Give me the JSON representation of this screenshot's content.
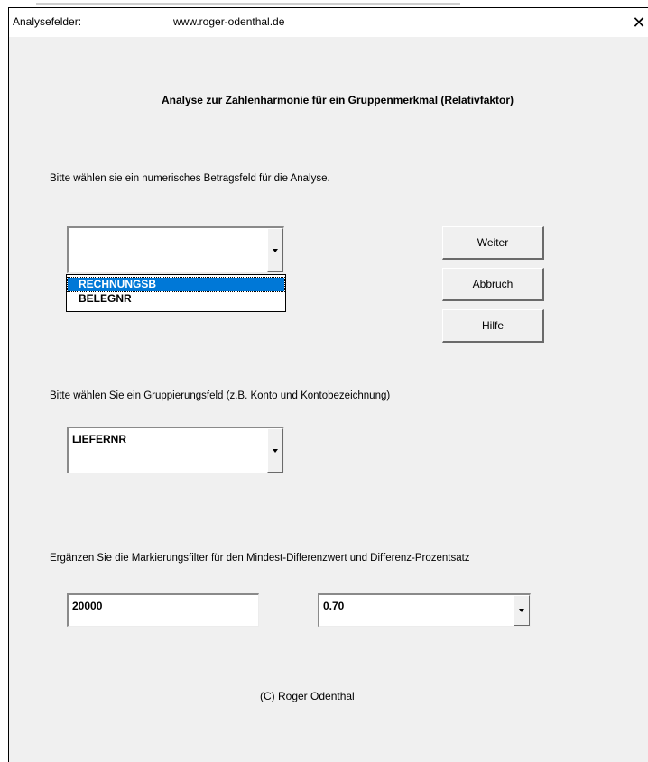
{
  "window": {
    "title": "Analysefelder:",
    "url": "www.roger-odenthal.de",
    "close_label": "✕"
  },
  "heading": "Analyse zur Zahlenharmonie für ein Gruppenmerkmal (Relativfaktor)",
  "amount_field": {
    "label": "Bitte wählen sie ein numerisches Betragsfeld für die Analyse.",
    "value": "",
    "options": [
      "RECHNUNGSB",
      "BELEGNR"
    ],
    "highlighted_option": "RECHNUNGSB"
  },
  "buttons": {
    "next": "Weiter",
    "cancel": "Abbruch",
    "help": "Hilfe"
  },
  "group_field": {
    "label": "Bitte wählen Sie ein Gruppierungsfeld (z.B. Konto und Kontobezeichnung)",
    "value": "LIEFERNR"
  },
  "filter": {
    "label": "Ergänzen Sie die Markierungsfilter für den Mindest-Differenzwert und Differenz-Prozentsatz",
    "min_diff_value": "20000",
    "percentage_value": "0.70"
  },
  "footer": {
    "copyright": "(C) Roger Odenthal"
  },
  "colors": {
    "dialog_bg": "#f0f0f0",
    "selection": "#0078d7"
  }
}
